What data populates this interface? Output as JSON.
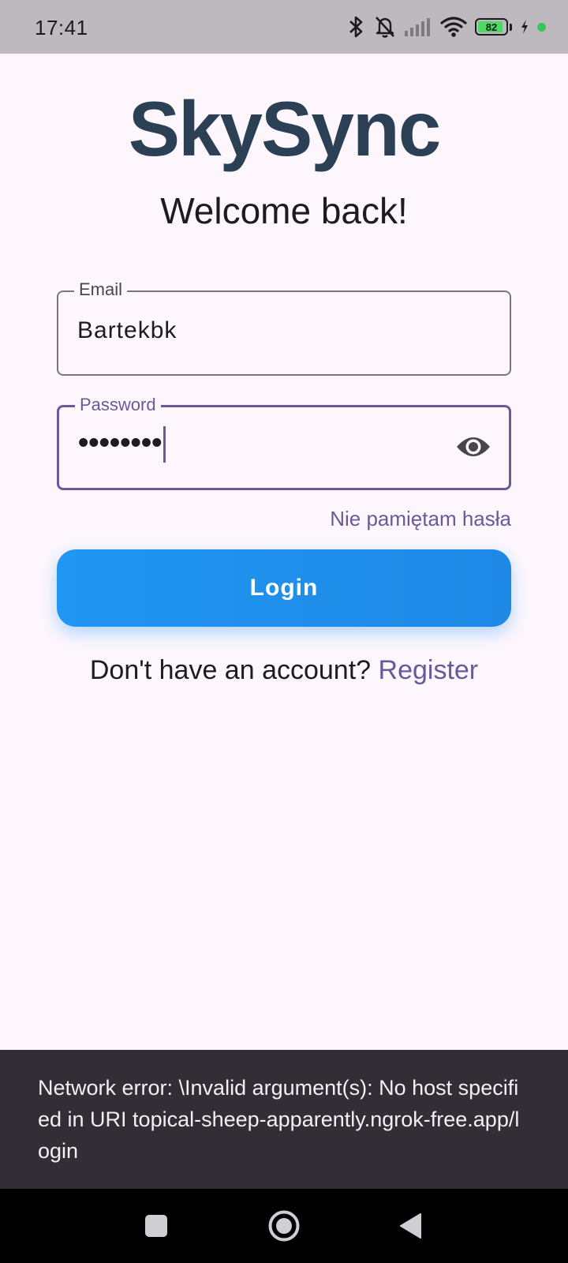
{
  "status_bar": {
    "time": "17:41",
    "battery_level": "82",
    "icons": [
      "bluetooth-icon",
      "bell-off-icon",
      "signal-icon",
      "wifi-icon",
      "battery-icon",
      "charging-icon"
    ]
  },
  "app": {
    "logo_text": "SkySync",
    "welcome_title": "Welcome back!"
  },
  "form": {
    "email": {
      "label": "Email",
      "value": "Bartekbk"
    },
    "password": {
      "label": "Password",
      "masked_value": "••••••••",
      "visibility_icon": "eye-icon"
    },
    "forgot_password_link": "Nie pamiętam hasła",
    "login_button": "Login",
    "register_prompt": "Don't have an account?",
    "register_link": "Register"
  },
  "snackbar": {
    "message": "Network error: \\Invalid argument(s): No host specified in URI topical-sheep-apparently.ngrok-free.app/login"
  },
  "nav_bar": {
    "buttons": [
      "recents-square-icon",
      "home-circle-icon",
      "back-triangle-icon"
    ]
  },
  "colors": {
    "accent": "#6b5898",
    "button": "#2196f3",
    "logo": "#2b3f55",
    "background": "#fdf7fd",
    "snackbar": "#312f35"
  }
}
